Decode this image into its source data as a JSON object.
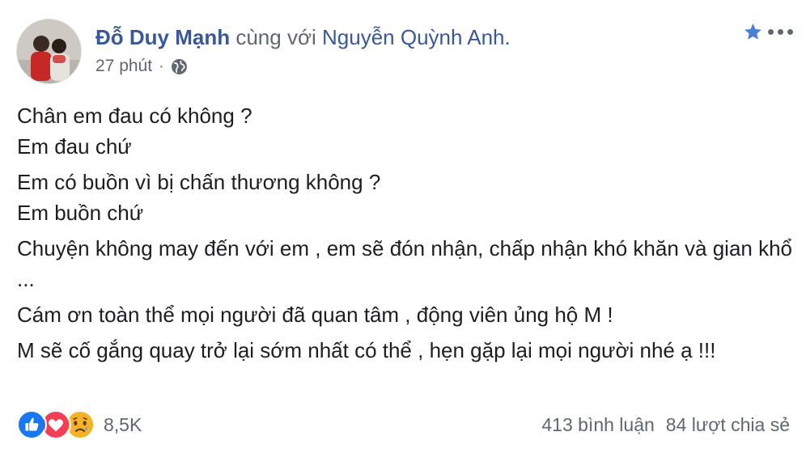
{
  "post": {
    "author": "Đỗ Duy Mạnh",
    "with_text": "cùng với",
    "tagged": "Nguyễn Quỳnh Anh.",
    "time": "27 phút",
    "dot": "·",
    "paragraphs": [
      "Chân em đau có không ?",
      "Em đau chứ",
      "Em có buồn vì bị chấn thương không ?",
      "Em buồn chứ",
      "Chuyện không may đến với em , em sẽ đón nhận, chấp nhận khó khăn và gian khổ ...",
      "Cám ơn toàn thể mọi người đã quan tâm , động viên ủng hộ M !",
      "M sẽ cố gắng quay trở lại sớm nhất có thể , hẹn gặp lại mọi người nhé ạ !!!"
    ]
  },
  "footer": {
    "reaction_icons": [
      "like-icon",
      "love-icon",
      "sad-icon"
    ],
    "reaction_count": "8,5K",
    "comments": "413 bình luận",
    "shares": "84 lượt chia sẻ"
  },
  "colors": {
    "link": "#385898",
    "secondary": "#606770",
    "like": "#1877f2",
    "love": "#f33e58",
    "sad": "#f7b125"
  }
}
